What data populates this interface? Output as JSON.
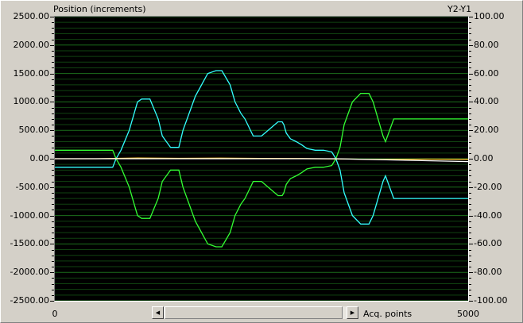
{
  "header": {
    "left_title": "Position (increments)",
    "right_title": "Y2-Y1"
  },
  "scrollbar": {
    "left_arrow": "◀",
    "right_arrow": "▶",
    "xlabel": "Acq. points"
  },
  "colors": {
    "background": "#d4d0c8",
    "plot_bg": "#000000",
    "grid": "#1f7a1f",
    "cyan": "#33ffff",
    "green": "#33ff33",
    "yellow": "#ffcc33",
    "white": "#ffffff"
  },
  "chart_data": {
    "type": "line",
    "title": "",
    "xlabel": "Acq. points",
    "ylabel": "Position (increments)",
    "y2label": "Y2-Y1",
    "xlim": [
      0,
      5000
    ],
    "ylim": [
      -2500,
      2500
    ],
    "y2lim": [
      -100,
      100
    ],
    "x_ticks": [
      "0",
      "5000"
    ],
    "y_ticks": [
      "2500.00",
      "2000.00",
      "1500.00",
      "1000.00",
      "500.00",
      "0.00",
      "-500.00",
      "-1000.00",
      "-1500.00",
      "-2000.00",
      "-2500.00"
    ],
    "y_tick_values": [
      2500,
      2000,
      1500,
      1000,
      500,
      0,
      -500,
      -1000,
      -1500,
      -2000,
      -2500
    ],
    "y2_ticks": [
      "100.00",
      "80.00",
      "60.00",
      "40.00",
      "20.00",
      "0.00",
      "-20.00",
      "-40.00",
      "-60.00",
      "-80.00",
      "-100.00"
    ],
    "y2_tick_values": [
      100,
      80,
      60,
      40,
      20,
      0,
      -20,
      -40,
      -60,
      -80,
      -100
    ],
    "grid": true,
    "series": [
      {
        "color": "#33ffff",
        "axis": "left",
        "x": [
          0,
          700,
          740,
          800,
          900,
          1000,
          1050,
          1150,
          1250,
          1300,
          1400,
          1500,
          1550,
          1700,
          1850,
          1950,
          2020,
          2120,
          2180,
          2250,
          2300,
          2350,
          2400,
          2500,
          2700,
          2750,
          2770,
          2800,
          2850,
          2920,
          2980,
          3050,
          3150,
          3250,
          3350,
          3400,
          3450,
          3500,
          3600,
          3700,
          3800,
          3850,
          3900,
          3970,
          4000,
          4050,
          4100,
          5000
        ],
        "y": [
          -150,
          -150,
          0,
          150,
          500,
          1000,
          1050,
          1050,
          700,
          400,
          200,
          200,
          500,
          1100,
          1500,
          1550,
          1550,
          1300,
          1000,
          800,
          700,
          550,
          400,
          400,
          650,
          650,
          600,
          450,
          350,
          300,
          250,
          180,
          150,
          150,
          120,
          0,
          -200,
          -600,
          -1000,
          -1150,
          -1150,
          -1000,
          -750,
          -400,
          -300,
          -500,
          -700,
          -700
        ]
      },
      {
        "color": "#33ff33",
        "axis": "left",
        "x": [
          0,
          700,
          740,
          800,
          900,
          1000,
          1050,
          1150,
          1250,
          1300,
          1400,
          1500,
          1550,
          1700,
          1850,
          1950,
          2020,
          2120,
          2180,
          2250,
          2300,
          2350,
          2400,
          2500,
          2700,
          2750,
          2770,
          2800,
          2850,
          2920,
          2980,
          3050,
          3150,
          3250,
          3350,
          3400,
          3450,
          3500,
          3600,
          3700,
          3800,
          3850,
          3900,
          3970,
          4000,
          4050,
          4100,
          5000
        ],
        "y": [
          150,
          150,
          0,
          -150,
          -500,
          -1000,
          -1050,
          -1050,
          -700,
          -400,
          -200,
          -200,
          -500,
          -1100,
          -1500,
          -1550,
          -1550,
          -1300,
          -1000,
          -800,
          -700,
          -550,
          -400,
          -400,
          -650,
          -650,
          -600,
          -450,
          -350,
          -300,
          -250,
          -180,
          -150,
          -150,
          -120,
          0,
          200,
          600,
          1000,
          1150,
          1150,
          1000,
          750,
          400,
          300,
          500,
          700,
          700
        ]
      },
      {
        "color": "#ffcc33",
        "axis": "right",
        "x": [
          0,
          500,
          1000,
          1500,
          2000,
          2500,
          3000,
          3500,
          4000,
          4500,
          5000
        ],
        "y": [
          0,
          0,
          0.5,
          0.3,
          0.4,
          0.2,
          0.1,
          -0.2,
          -0.5,
          -0.3,
          -0.4
        ]
      },
      {
        "color": "#ffffff",
        "axis": "right",
        "x": [
          0,
          3400,
          5000
        ],
        "y": [
          0,
          0,
          -2
        ]
      }
    ]
  }
}
